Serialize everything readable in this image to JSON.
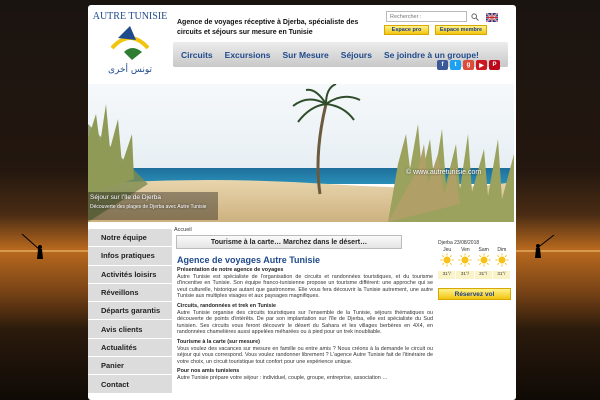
{
  "brand": {
    "name": "AUTRE TUNISIE",
    "arabic": "تونس أخرى"
  },
  "tagline": "Agence de voyages réceptive à Djerba, spécialiste des circuits et séjours sur mesure en Tunisie",
  "search": {
    "placeholder": "Rechercher :"
  },
  "header_buttons": {
    "pro": "Espace pro",
    "member": "Espace membre"
  },
  "nav": [
    "Circuits",
    "Excursions",
    "Sur Mesure",
    "Séjours",
    "Se joindre à un groupe!"
  ],
  "socials": [
    "f",
    "t",
    "g",
    "▶",
    "P"
  ],
  "hero": {
    "watermark": "© www.autretunisie.com",
    "caption_title": "Séjour sur l'île de Djerba",
    "caption_sub": "Découverte des plages de Djerba avec Autre Tunisie"
  },
  "sidebar": [
    "Notre équipe",
    "Infos pratiques",
    "Activités loisirs",
    "Réveillons",
    "Départs garantis",
    "Avis clients",
    "Actualités",
    "Panier",
    "Contact"
  ],
  "breadcrumb": "Accueil",
  "banner": "Tourisme à la carte…  Marchez dans le désert…",
  "heading": "Agence de voyages Autre Tunisie",
  "paragraphs": [
    {
      "title": "Présentation de notre agence de voyages",
      "text": "Autre Tunisie est spécialiste de l'organisation de circuits et randonnées touristiques, et du tourisme d'incentive en Tunisie. Son équipe franco-tunisienne propose un tourisme différent: une approche qui se veut culturelle, historique autant que gastronome. Elle vous fera découvrir la Tunisie autrement, une autre Tunisie aux multiples visages et aux paysages magnifiques."
    },
    {
      "title": "Circuits, randonnées et trek en Tunisie",
      "text": "Autre Tunisie organise des circuits touristiques sur l'ensemble de la Tunisie, séjours thématiques ou découverte de points d'intérêts. De par son implantation sur l'île de Djerba, elle est spécialiste du Sud tunisien. Ses circuits vous feront découvrir le désert du Sahara et les villages berbères en 4X4, en randonnées chamelières aussi appelées méharées ou à pied pour un trek inoubliable."
    },
    {
      "title": "Tourisme à la carte  (sur mesure)",
      "text": "Vous voulez des vacances sur mesure en famille ou entre amis ? Nous créons à la demande le circuit ou séjour qui vous correspond. Vous voulez randonner librement ? L'agence Autre Tunisie fait de l'itinéraire de votre choix, un circuit touristique tout confort pour une expérience unique."
    },
    {
      "title": "Pour nos amis tunisiens",
      "text": "Autre Tunisie prépare votre séjour : individuel, couple, groupe, entreprise, association …"
    }
  ],
  "weather": {
    "title": "Djerba 23/08/2018",
    "days": [
      "Jeu",
      "Ven",
      "Sam",
      "Dim"
    ],
    "temps": [
      "31°/",
      "31°/",
      "31°/",
      "31°/"
    ]
  },
  "reserve_label": "Réservez vol",
  "colors": {
    "link_blue": "#1f4a8c",
    "button_yellow": "#f1c40f",
    "sidebar_grey": "#dcdcdc"
  }
}
